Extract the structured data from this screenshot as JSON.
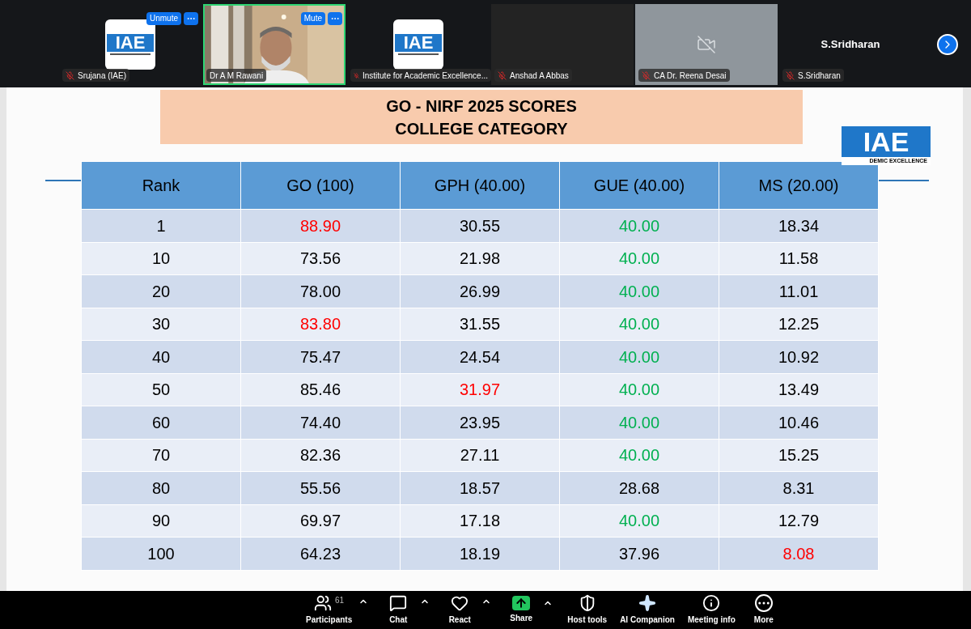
{
  "participants": [
    {
      "kind": "logo",
      "name": "Srujana (IAE)",
      "muted": true,
      "speaking": false,
      "logo_text": "IAE",
      "mute_button": "Unmute"
    },
    {
      "kind": "video",
      "name": "Dr A M Rawani",
      "muted": false,
      "speaking": true,
      "mute_button": "Mute"
    },
    {
      "kind": "logo",
      "name": "Institute for Academic Excellence...",
      "muted": true,
      "speaking": false,
      "logo_text": "IAE"
    },
    {
      "kind": "blank",
      "name": "Anshad A Abbas",
      "muted": true,
      "speaking": false
    },
    {
      "kind": "camera_off",
      "name": "CA Dr. Reena Desai",
      "muted": true,
      "speaking": false
    },
    {
      "kind": "name",
      "name": "S.Sridharan",
      "muted": true,
      "speaking": false,
      "display": "S.Sridharan"
    }
  ],
  "slide": {
    "title_lines": [
      "GO - NIRF 2025 SCORES",
      "COLLEGE CATEGORY"
    ],
    "logo_text": "IAE",
    "logo_subtext": "DEMIC EXCELLENCE",
    "table": {
      "columns": [
        "Rank",
        "GO (100)",
        "GPH (40.00)",
        "GUE (40.00)",
        "MS (20.00)"
      ],
      "rows": [
        [
          {
            "text": "1",
            "color": "#000000"
          },
          {
            "text": "88.90",
            "color": "#ff0000"
          },
          {
            "text": "30.55",
            "color": "#000000"
          },
          {
            "text": "40.00",
            "color": "#00b050"
          },
          {
            "text": "18.34",
            "color": "#000000"
          }
        ],
        [
          {
            "text": "10",
            "color": "#000000"
          },
          {
            "text": "73.56",
            "color": "#000000"
          },
          {
            "text": "21.98",
            "color": "#000000"
          },
          {
            "text": "40.00",
            "color": "#00b050"
          },
          {
            "text": "11.58",
            "color": "#000000"
          }
        ],
        [
          {
            "text": "20",
            "color": "#000000"
          },
          {
            "text": "78.00",
            "color": "#000000"
          },
          {
            "text": "26.99",
            "color": "#000000"
          },
          {
            "text": "40.00",
            "color": "#00b050"
          },
          {
            "text": "11.01",
            "color": "#000000"
          }
        ],
        [
          {
            "text": "30",
            "color": "#000000"
          },
          {
            "text": "83.80",
            "color": "#ff0000"
          },
          {
            "text": "31.55",
            "color": "#000000"
          },
          {
            "text": "40.00",
            "color": "#00b050"
          },
          {
            "text": "12.25",
            "color": "#000000"
          }
        ],
        [
          {
            "text": "40",
            "color": "#000000"
          },
          {
            "text": "75.47",
            "color": "#000000"
          },
          {
            "text": "24.54",
            "color": "#000000"
          },
          {
            "text": "40.00",
            "color": "#00b050"
          },
          {
            "text": "10.92",
            "color": "#000000"
          }
        ],
        [
          {
            "text": "50",
            "color": "#000000"
          },
          {
            "text": "85.46",
            "color": "#000000"
          },
          {
            "text": "31.97",
            "color": "#ff0000"
          },
          {
            "text": "40.00",
            "color": "#00b050"
          },
          {
            "text": "13.49",
            "color": "#000000"
          }
        ],
        [
          {
            "text": "60",
            "color": "#000000"
          },
          {
            "text": "74.40",
            "color": "#000000"
          },
          {
            "text": "23.95",
            "color": "#000000"
          },
          {
            "text": "40.00",
            "color": "#00b050"
          },
          {
            "text": "10.46",
            "color": "#000000"
          }
        ],
        [
          {
            "text": "70",
            "color": "#000000"
          },
          {
            "text": "82.36",
            "color": "#000000"
          },
          {
            "text": "27.11",
            "color": "#000000"
          },
          {
            "text": "40.00",
            "color": "#00b050"
          },
          {
            "text": "15.25",
            "color": "#000000"
          }
        ],
        [
          {
            "text": "80",
            "color": "#000000"
          },
          {
            "text": "55.56",
            "color": "#000000"
          },
          {
            "text": "18.57",
            "color": "#000000"
          },
          {
            "text": "28.68",
            "color": "#000000"
          },
          {
            "text": "8.31",
            "color": "#000000"
          }
        ],
        [
          {
            "text": "90",
            "color": "#000000"
          },
          {
            "text": "69.97",
            "color": "#000000"
          },
          {
            "text": "17.18",
            "color": "#000000"
          },
          {
            "text": "40.00",
            "color": "#00b050"
          },
          {
            "text": "12.79",
            "color": "#000000"
          }
        ],
        [
          {
            "text": "100",
            "color": "#000000"
          },
          {
            "text": "64.23",
            "color": "#000000"
          },
          {
            "text": "18.19",
            "color": "#000000"
          },
          {
            "text": "37.96",
            "color": "#000000"
          },
          {
            "text": "8.08",
            "color": "#ff0000"
          }
        ]
      ]
    }
  },
  "toolbar": [
    {
      "kind": "participants",
      "label": "Participants",
      "count": "61",
      "caret": true
    },
    {
      "kind": "chat",
      "label": "Chat",
      "caret": true
    },
    {
      "kind": "react",
      "label": "React",
      "caret": true
    },
    {
      "kind": "share",
      "label": "Share",
      "caret": true
    },
    {
      "kind": "host",
      "label": "Host tools",
      "caret": false
    },
    {
      "kind": "ai",
      "label": "AI Companion",
      "caret": false
    },
    {
      "kind": "info",
      "label": "Meeting info",
      "caret": false
    },
    {
      "kind": "more",
      "label": "More",
      "caret": false
    }
  ]
}
